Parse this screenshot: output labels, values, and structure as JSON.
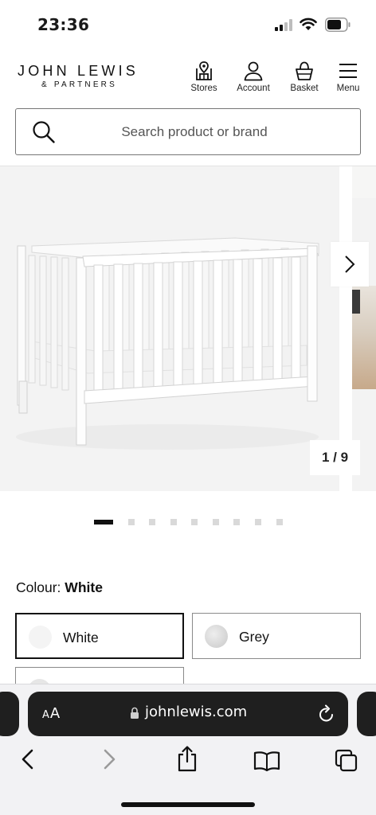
{
  "status_bar": {
    "time": "23:36"
  },
  "header": {
    "brand_line1": "JOHN LEWIS",
    "brand_line2": "& PARTNERS",
    "nav": [
      {
        "label": "Stores",
        "icon": "store-icon"
      },
      {
        "label": "Account",
        "icon": "account-icon"
      },
      {
        "label": "Basket",
        "icon": "basket-icon"
      },
      {
        "label": "Menu",
        "icon": "menu-icon"
      }
    ]
  },
  "search": {
    "placeholder": "Search product or brand",
    "icon": "search-icon"
  },
  "gallery": {
    "counter": "1 / 9",
    "total_dots": 9,
    "active_dot": 1,
    "next_icon": "chevron-right-icon",
    "product_image": "white-cot-bed-image"
  },
  "colour": {
    "label": "Colour:",
    "selected": "White",
    "options": [
      {
        "name": "White",
        "chip_color": "#f4f4f4",
        "selected": true
      },
      {
        "name": "Grey",
        "chip_color": "#d4d4d4",
        "selected": false
      },
      {
        "name": "",
        "chip_color": "#e6e6e6",
        "selected": false
      }
    ]
  },
  "safari": {
    "text_size_label": "AA",
    "url": "johnlewis.com",
    "toolbar_icons": [
      "back-icon",
      "forward-icon",
      "share-icon",
      "bookmarks-icon",
      "tabs-icon"
    ]
  },
  "colors": {
    "text": "#1a1a1a",
    "border": "#767676",
    "gallery_bg": "#f3f3f3",
    "safari_bar": "#1f1f1f"
  }
}
